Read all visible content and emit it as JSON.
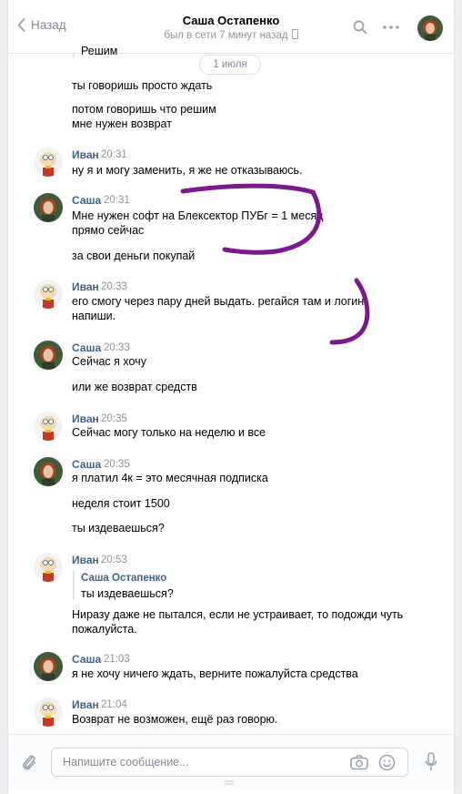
{
  "header": {
    "back_label": "Назад",
    "title": "Саша Остапенко",
    "status": "был в сети 7 минут назад"
  },
  "top_quote": "Решим",
  "date_pill": "1 июля",
  "lines": [
    "ты говоришь просто ждать",
    "потом говоришь что решим",
    "мне нужен возврат"
  ],
  "messages": [
    {
      "author": "Иван",
      "time": "20:31",
      "lines": [
        "ну я и могу заменить, я же не отказываюсь."
      ]
    },
    {
      "author": "Саша",
      "time": "20:31",
      "lines": [
        "Мне нужен софт на Блексектор ПУБг = 1 месяц",
        "прямо сейчас",
        "за свои деньги покупай"
      ]
    },
    {
      "author": "Иван",
      "time": "20:33",
      "lines": [
        "его смогу через пару дней выдать. регайся там и логин",
        "напиши."
      ]
    },
    {
      "author": "Саша",
      "time": "20:33",
      "lines": [
        "Сейчас я хочу",
        "или же возврат средств"
      ]
    },
    {
      "author": "Иван",
      "time": "20:35",
      "lines": [
        "Сейчас могу только на неделю и все"
      ]
    },
    {
      "author": "Саша",
      "time": "20:35",
      "lines": [
        "я платил 4к = это месячная подписка",
        "неделя стоит 1500",
        "ты издеваешься?"
      ]
    },
    {
      "author": "Иван",
      "time": "20:53",
      "quote_author": "Саша Остапенко",
      "quote_text": "ты издеваешься?",
      "lines": [
        "Ниразу даже не пытался, если не устраивает, то подожди чуть",
        "пожалуйста."
      ]
    },
    {
      "author": "Саша",
      "time": "21:03",
      "lines": [
        "я не хочу ничего ждать, верните пожалуйста средства"
      ]
    },
    {
      "author": "Иван",
      "time": "21:04",
      "lines": [
        "Возврат не возможен, ещё раз говорю."
      ]
    }
  ],
  "composer": {
    "placeholder": "Напишите сообщение..."
  },
  "colors": {
    "link": "#42648b",
    "muted": "#828a99",
    "annotation": "#7b1a8c"
  }
}
